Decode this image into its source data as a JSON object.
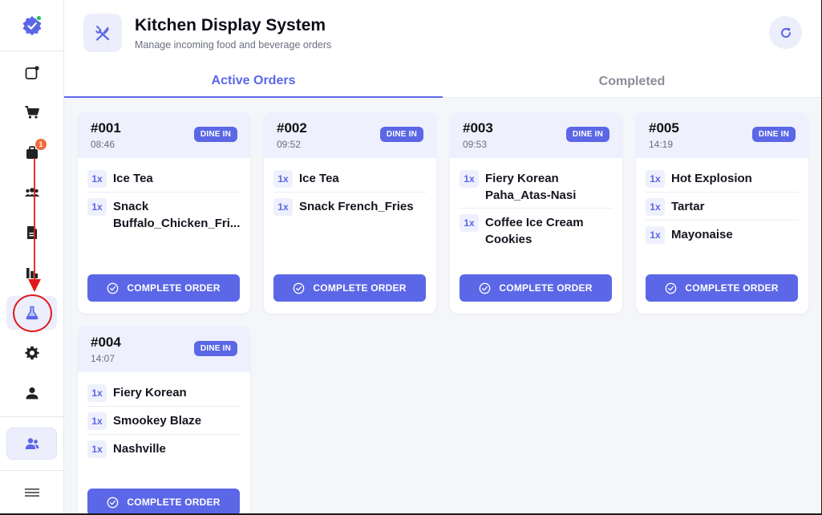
{
  "header": {
    "title": "Kitchen Display System",
    "subtitle": "Manage incoming food and beverage orders"
  },
  "tabs": [
    {
      "label": "Active Orders",
      "active": true
    },
    {
      "label": "Completed",
      "active": false
    }
  ],
  "sidebar": {
    "items": [
      {
        "icon": "new-order-icon"
      },
      {
        "icon": "cart-icon"
      },
      {
        "icon": "bag-icon",
        "badge": "1"
      },
      {
        "icon": "people-icon"
      },
      {
        "icon": "document-icon"
      },
      {
        "icon": "bar-chart-icon"
      },
      {
        "icon": "kitchen-flask-icon",
        "active": true
      },
      {
        "icon": "gear-icon"
      },
      {
        "icon": "user-icon"
      }
    ],
    "bottom_icon": "staff-icon",
    "menu_icon": "hamburger-icon"
  },
  "colors": {
    "accent": "#5b67e6",
    "accent_light": "#eef0fd",
    "badge": "#f26b3a",
    "annotation": "#e01b1b"
  },
  "complete_label": "COMPLETE ORDER",
  "orders": [
    {
      "number": "#001",
      "time": "08:46",
      "type": "DINE IN",
      "items": [
        {
          "qty": "1x",
          "name": "Ice Tea"
        },
        {
          "qty": "1x",
          "name": "Snack Buffalo_Chicken_Fri..."
        }
      ]
    },
    {
      "number": "#002",
      "time": "09:52",
      "type": "DINE IN",
      "items": [
        {
          "qty": "1x",
          "name": "Ice Tea"
        },
        {
          "qty": "1x",
          "name": "Snack French_Fries"
        }
      ]
    },
    {
      "number": "#003",
      "time": "09:53",
      "type": "DINE IN",
      "items": [
        {
          "qty": "1x",
          "name": "Fiery Korean Paha_Atas-Nasi"
        },
        {
          "qty": "1x",
          "name": "Coffee Ice Cream Cookies"
        }
      ]
    },
    {
      "number": "#005",
      "time": "14:19",
      "type": "DINE IN",
      "items": [
        {
          "qty": "1x",
          "name": "Hot Explosion"
        },
        {
          "qty": "1x",
          "name": "Tartar"
        },
        {
          "qty": "1x",
          "name": "Mayonaise"
        }
      ]
    },
    {
      "number": "#004",
      "time": "14:07",
      "type": "DINE IN",
      "items": [
        {
          "qty": "1x",
          "name": "Fiery Korean"
        },
        {
          "qty": "1x",
          "name": "Smookey Blaze"
        },
        {
          "qty": "1x",
          "name": "Nashville"
        }
      ]
    }
  ]
}
